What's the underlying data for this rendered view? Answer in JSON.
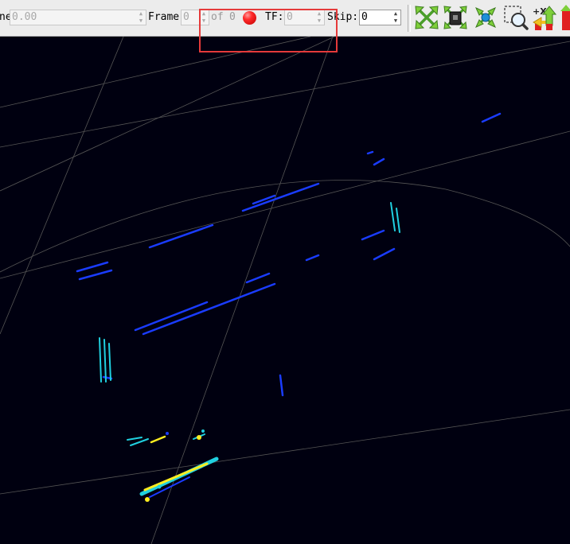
{
  "toolbar": {
    "time_label": "ne",
    "time_value": "0.00",
    "frame_label": "Frame",
    "frame_value": "0",
    "of_label": "of",
    "frame_total": "0",
    "tf_label": "TF:",
    "tf_value": "0",
    "skip_label": "Skip:",
    "skip_value": "0"
  },
  "icons": [
    "fit-all-icon",
    "reset-view-icon",
    "center-view-icon",
    "zoom-region-icon",
    "axis-up-icon"
  ],
  "colors": {
    "toolbar_bg": "#ececec",
    "viewport_bg": "#000010",
    "grid_line": "#5a5a5a",
    "point_blue": "#1a3cff",
    "point_cyan": "#20d0e0",
    "point_yellow": "#ffee20",
    "highlight_box": "#e53a3a"
  }
}
